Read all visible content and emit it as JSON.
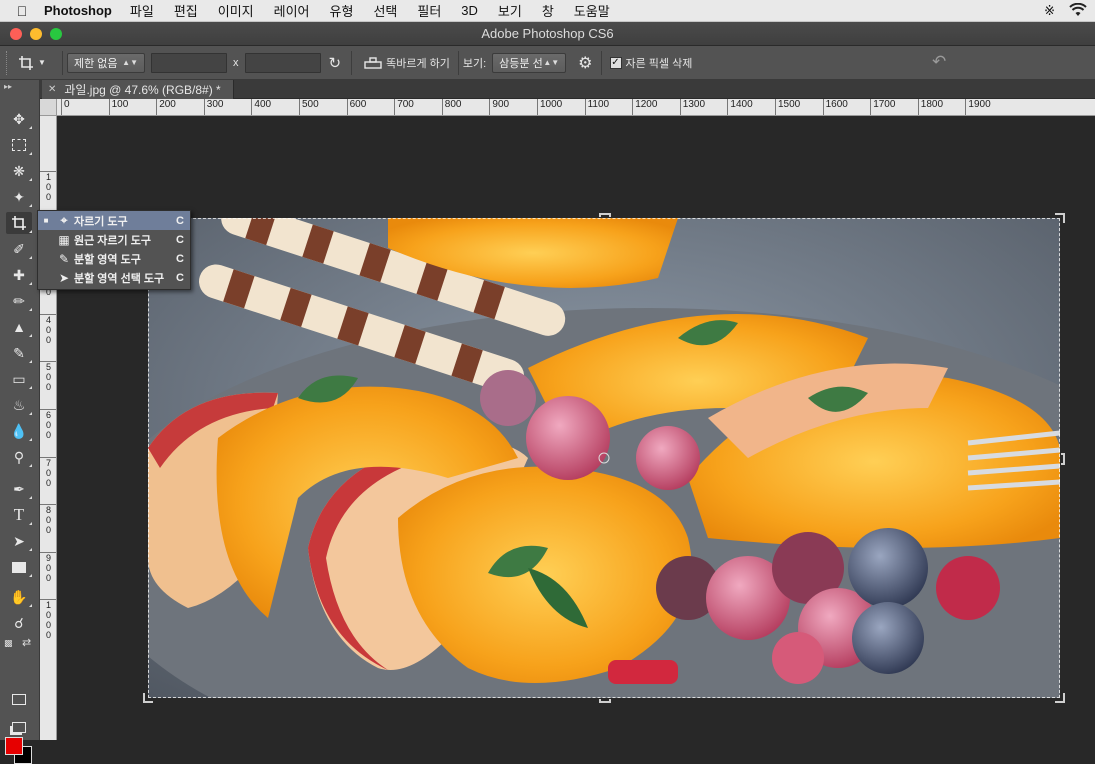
{
  "menubar": {
    "app": "Photoshop",
    "menus": [
      "파일",
      "편집",
      "이미지",
      "레이어",
      "유형",
      "선택",
      "필터",
      "3D",
      "보기",
      "창",
      "도움말"
    ]
  },
  "window": {
    "title": "Adobe Photoshop CS6"
  },
  "options": {
    "ratio_value": "제한 없음",
    "separator_x": "x",
    "straighten_label": "똑바르게 하기",
    "view_label": "보기:",
    "view_value": "삼등분 선",
    "delete_pixels_label": "자른 픽셀 삭제",
    "delete_pixels_checked": true
  },
  "document": {
    "tab_label": "과일.jpg @ 47.6% (RGB/8#) *"
  },
  "rulers": {
    "horizontal": [
      "0",
      "100",
      "200",
      "300",
      "400",
      "500",
      "600",
      "700",
      "800",
      "900",
      "1000",
      "1100",
      "1200",
      "1300",
      "1400",
      "1500",
      "1600",
      "1700",
      "1800",
      "1900"
    ],
    "vertical": [
      "1\n0\n0",
      "2\n0\n0",
      "3\n0\n0",
      "4\n0\n0",
      "5\n0\n0",
      "6\n0\n0",
      "7\n0\n0",
      "8\n0\n0",
      "9\n0\n0",
      "1\n0\n0\n0"
    ]
  },
  "flyout": {
    "items": [
      {
        "label": "자르기 도구",
        "shortcut": "C",
        "icon": "crop-icon",
        "selected": true
      },
      {
        "label": "원근 자르기 도구",
        "shortcut": "C",
        "icon": "perspective-crop-icon",
        "selected": false
      },
      {
        "label": "분할 영역 도구",
        "shortcut": "C",
        "icon": "slice-icon",
        "selected": false
      },
      {
        "label": "분할 영역 선택 도구",
        "shortcut": "C",
        "icon": "slice-select-icon",
        "selected": false
      }
    ]
  },
  "colors": {
    "foreground": "#e60000",
    "background": "#000000"
  }
}
